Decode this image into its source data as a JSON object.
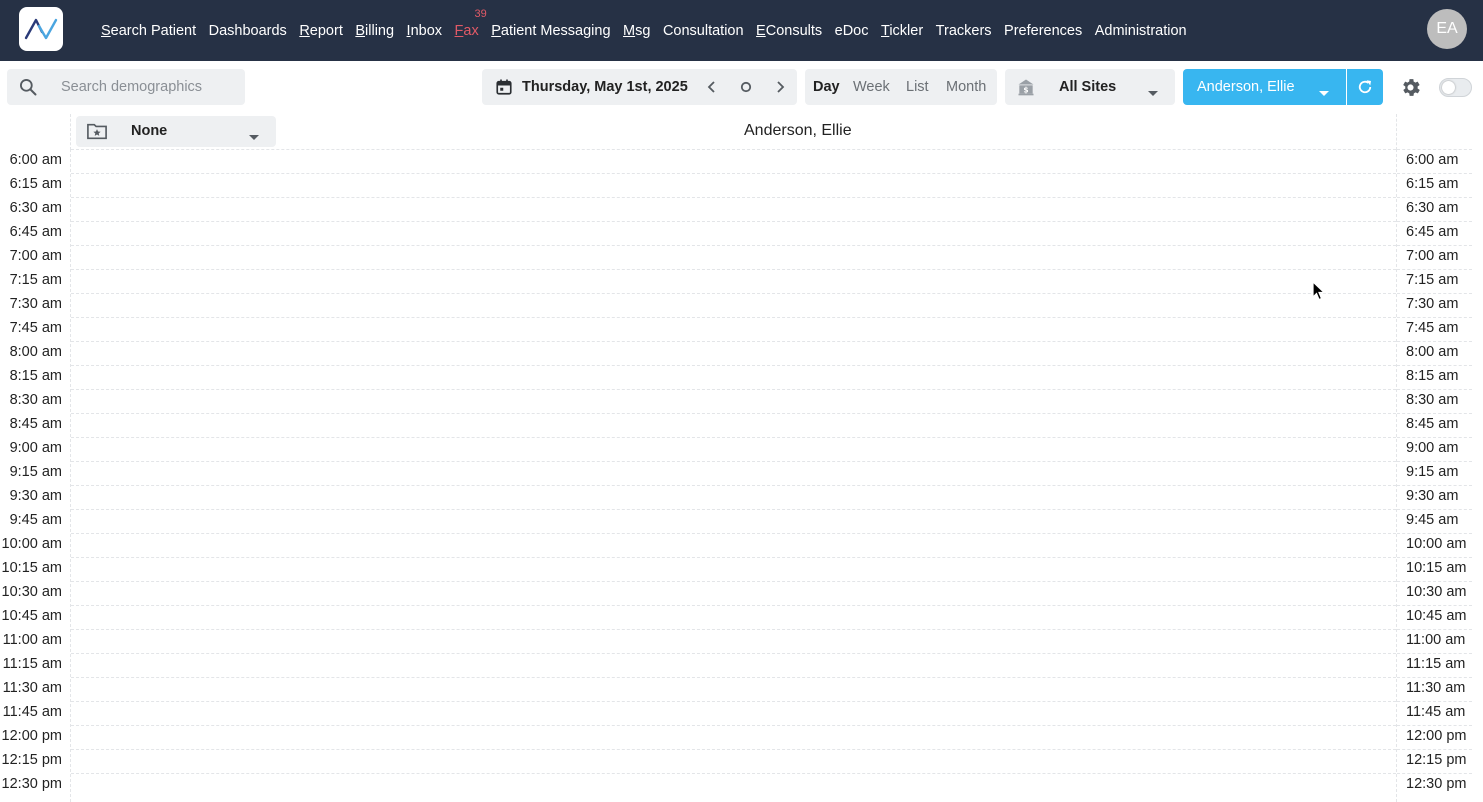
{
  "topnav": {
    "logo_text": "AV",
    "items": [
      {
        "label": "Search Patient",
        "underline": true
      },
      {
        "label": "Dashboards",
        "underline": false
      },
      {
        "label": "Report",
        "underline": true
      },
      {
        "label": "Billing",
        "underline": true
      },
      {
        "label": "Inbox",
        "underline": true
      },
      {
        "label": "Fax",
        "underline": true,
        "badge": "39"
      },
      {
        "label": "Patient Messaging",
        "underline": true
      },
      {
        "label": "Msg",
        "underline": true
      },
      {
        "label": "Consultation",
        "underline": false
      },
      {
        "label": "EConsults",
        "underline": true
      },
      {
        "label": "eDoc",
        "underline": false
      },
      {
        "label": "Tickler",
        "underline": true
      },
      {
        "label": "Trackers",
        "underline": false
      },
      {
        "label": "Preferences",
        "underline": false
      },
      {
        "label": "Administration",
        "underline": false
      }
    ],
    "avatar_initials": "EA"
  },
  "toolbar": {
    "search_placeholder": "Search demographics",
    "date_label": "Thursday, May 1st, 2025",
    "views": [
      "Day",
      "Week",
      "List",
      "Month"
    ],
    "active_view": "Day",
    "site_label": "All Sites",
    "provider_label": "Anderson, Ellie"
  },
  "schedule": {
    "template_label": "None",
    "provider_column_title": "Anderson, Ellie",
    "time_slots": [
      "6:00 am",
      "6:15 am",
      "6:30 am",
      "6:45 am",
      "7:00 am",
      "7:15 am",
      "7:30 am",
      "7:45 am",
      "8:00 am",
      "8:15 am",
      "8:30 am",
      "8:45 am",
      "9:00 am",
      "9:15 am",
      "9:30 am",
      "9:45 am",
      "10:00 am",
      "10:15 am",
      "10:30 am",
      "10:45 am",
      "11:00 am",
      "11:15 am",
      "11:30 am",
      "11:45 am",
      "12:00 pm",
      "12:15 pm",
      "12:30 pm"
    ]
  },
  "colors": {
    "topbar_bg": "#263145",
    "accent": "#38b6f0",
    "fax_alert": "#e05a67",
    "control_bg": "#eef0f2"
  },
  "icons": {
    "search": "search-icon",
    "calendar": "calendar-icon",
    "prev": "chevron-left-icon",
    "today": "circle-icon",
    "next": "chevron-right-icon",
    "site": "bank-icon",
    "dropdown": "caret-down-icon",
    "refresh": "refresh-icon",
    "settings": "gear-icon",
    "template": "folder-star-icon"
  }
}
